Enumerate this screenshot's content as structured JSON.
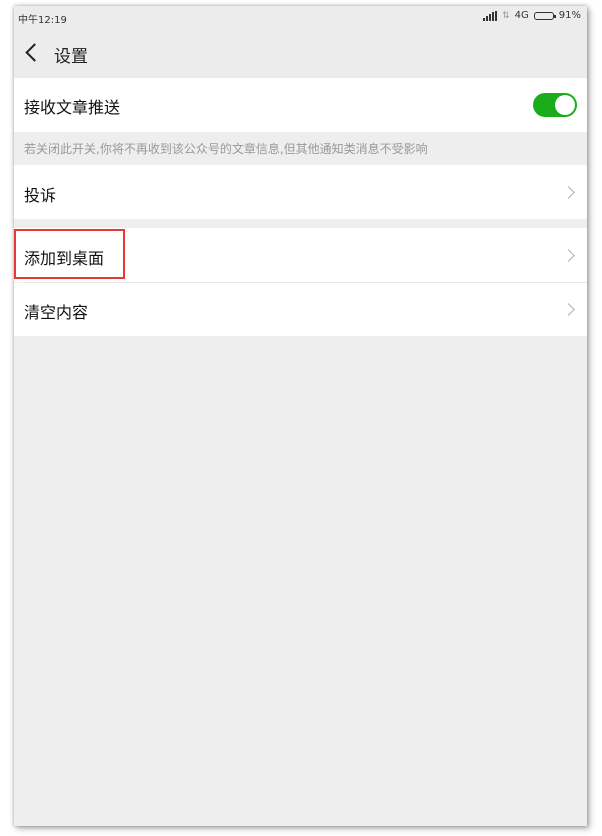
{
  "status_bar": {
    "time": "中午12:19",
    "network": "4G",
    "battery": "91%"
  },
  "nav": {
    "title": "设置"
  },
  "settings": {
    "push_label": "接收文章推送",
    "push_enabled": true,
    "push_hint": "若关闭此开关,你将不再收到该公众号的文章信息,但其他通知类消息不受影响",
    "complaint_label": "投诉",
    "add_desktop_label": "添加到桌面",
    "clear_label": "清空内容"
  },
  "colors": {
    "toggle_on": "#1aad19",
    "highlight": "#e53935"
  }
}
